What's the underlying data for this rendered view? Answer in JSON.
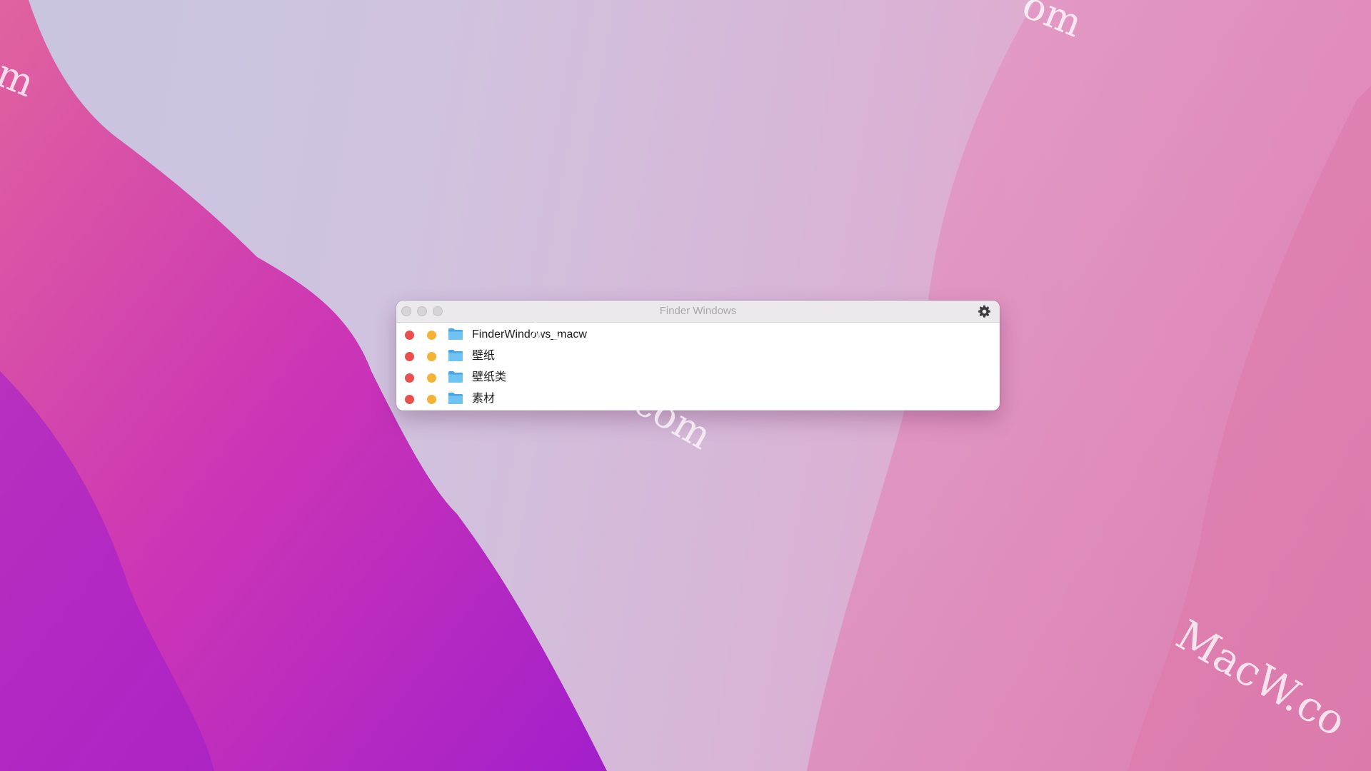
{
  "window": {
    "title": "Finder Windows",
    "settings_icon": "gear-icon"
  },
  "items": [
    {
      "label": "FinderWindows_macw",
      "icon": "folder-icon"
    },
    {
      "label": "壁纸",
      "icon": "folder-icon"
    },
    {
      "label": "壁纸类",
      "icon": "folder-icon"
    },
    {
      "label": "素材",
      "icon": "folder-icon"
    }
  ],
  "watermarks": {
    "center": "MacW.com",
    "bottom_right": "MacW.co",
    "top_right": "om",
    "top_left": "m"
  },
  "colors": {
    "close_dot": "#ec4f4b",
    "minimize_dot": "#f3b436",
    "folder": "#5bb4ea"
  }
}
